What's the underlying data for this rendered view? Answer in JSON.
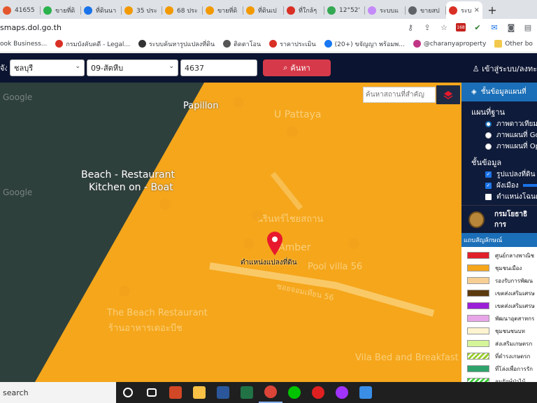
{
  "browser": {
    "tabs": [
      {
        "label": "41655",
        "color": "#e4572e"
      },
      {
        "label": "ขายที่ดิ",
        "color": "#2bb24c"
      },
      {
        "label": "ที่ดินนา",
        "color": "#1a73e8"
      },
      {
        "label": "35 ประ",
        "color": "#f29900"
      },
      {
        "label": "68 ประ",
        "color": "#f29900"
      },
      {
        "label": "ขายที่ดิ",
        "color": "#f29900"
      },
      {
        "label": "ที่ดินเป",
        "color": "#f29900"
      },
      {
        "label": "ที่ใกล้ๆ",
        "color": "#d93025"
      },
      {
        "label": "12°52'",
        "color": "#34a853"
      },
      {
        "label": "ระบบแ",
        "color": "#c58af9"
      },
      {
        "label": "ขายสป",
        "color": "#5f6368"
      },
      {
        "label": "ระบ",
        "color": "#d93025",
        "active": true
      }
    ],
    "new_tab": "+",
    "close_tab": "×",
    "url": "smaps.dol.go.th",
    "bookmarks": [
      {
        "label": "ook Business...",
        "color": "#1a73e8"
      },
      {
        "label": "กรมบังคับคดี - Legal...",
        "color": "#d93025"
      },
      {
        "label": "ระบบค้นหารูปแปลงที่ดิน",
        "color": "#333333"
      },
      {
        "label": "ติดตาโอน",
        "color": "#555555"
      },
      {
        "label": "ราคาประเมิน",
        "color": "#d93025"
      },
      {
        "label": "(20+) ขจัญญา พร้อมพ...",
        "color": "#1877f2"
      },
      {
        "label": "@charanyaproperty",
        "color": "#c13584"
      }
    ],
    "other_bookmarks": "Other bo",
    "omni_badge": "168"
  },
  "app": {
    "province_label": "จังหวัด",
    "province": "ชลบุรี",
    "office": "09-สัตหีบ",
    "parcel_number": "4637",
    "search_button": "ค้นหา",
    "login": "เข้าสู่ระบบ/ลงทะ",
    "place_search_placeholder": "ค้นหาสถานที่สำคัญ"
  },
  "map": {
    "labels": {
      "papillon": "Papillon",
      "u_pattaya": "U Pattaya",
      "beach_restaurant_1": "Beach - Restaurant",
      "beach_restaurant_2": "Kitchen on - Boat",
      "thai_label": "นรินทร์ไชยสถาน",
      "amber": "Amber",
      "pool_villa": "Pool villa 56",
      "soi": "ซอยจอมเทียน 56",
      "beach_rest_2": "The Beach Restaurant",
      "beach_rest_2_th": "ร้านอาหารเดอะบีช",
      "vila_bed": "Vila Bed and Breakfast",
      "parcel_marker": "ตำแหน่งแปลงที่ดิน",
      "google": "Google",
      "google_top": "Google"
    }
  },
  "panel": {
    "title": "ชั้นข้อมูลแผนที่",
    "basemap_title": "แผนที่ฐาน",
    "basemaps": [
      {
        "label": "ภาพดาวเทียม",
        "selected": true
      },
      {
        "label": "ภาพแผนที่ Go",
        "selected": false
      },
      {
        "label": "ภาพแผนที่ Op",
        "selected": false
      }
    ],
    "layers_title": "ชั้นข้อมูล",
    "layers": [
      {
        "label": "รูปแปลงที่ดิน",
        "checked": true
      },
      {
        "label": "ผังเมือง",
        "checked": true
      },
      {
        "label": "ตำแหน่งโฉนด",
        "checked": false
      }
    ],
    "org_name": "กรมโยธาธิการ",
    "legend_title": "แถบสัญลักษณ์",
    "legend": [
      {
        "label": "ศูนย์กลางพาณิช",
        "color": "#e0202a",
        "pattern": false
      },
      {
        "label": "ชุมชนเมือง",
        "color": "#f5a61b",
        "pattern": false
      },
      {
        "label": "รองรับการพัฒน",
        "color": "#f7cf95",
        "pattern": false
      },
      {
        "label": "เขตส่งเสริมเศรษ",
        "color": "#5c3a10",
        "pattern": false
      },
      {
        "label": "เขตส่งเสริมเศรษ",
        "color": "#9b1fd6",
        "pattern": false
      },
      {
        "label": "พัฒนาอุตสาหกร",
        "color": "#e8a6e8",
        "pattern": false
      },
      {
        "label": "ชุมชนชนบท",
        "color": "#fff4d0",
        "pattern": false
      },
      {
        "label": "ส่งเสริมเกษตรก",
        "color": "#d5f59a",
        "pattern": false
      },
      {
        "label": "ที่ดำรงเกษตรก",
        "color": "#9acd32",
        "pattern": true
      },
      {
        "label": "ที่โล่งเพื่อการรัก",
        "color": "#2ea36b",
        "pattern": false
      },
      {
        "label": "อนุรักษ์ป่าไม้",
        "color": "#3cd13c",
        "pattern": true
      }
    ]
  },
  "taskbar": {
    "search": "search",
    "apps": [
      {
        "name": "cortana-icon",
        "color": "#ffffff"
      },
      {
        "name": "task-view-icon",
        "color": "#ffffff"
      },
      {
        "name": "powerpoint-icon",
        "color": "#d24726"
      },
      {
        "name": "file-explorer-icon",
        "color": "#f8c146"
      },
      {
        "name": "word-icon",
        "color": "#2b579a"
      },
      {
        "name": "excel-icon",
        "color": "#217346"
      },
      {
        "name": "chrome-icon",
        "color": "#db4437"
      },
      {
        "name": "line-icon",
        "color": "#00c300"
      },
      {
        "name": "record-icon",
        "color": "#e02020"
      },
      {
        "name": "messenger-icon",
        "color": "#a033ff"
      },
      {
        "name": "photos-icon",
        "color": "#3a8ee6"
      }
    ]
  },
  "colors": {
    "header_bg": "#0b1430",
    "search_button": "#d63a4a",
    "zone_orange": "#f5a61b",
    "panel_blue": "#1b6fb8"
  }
}
